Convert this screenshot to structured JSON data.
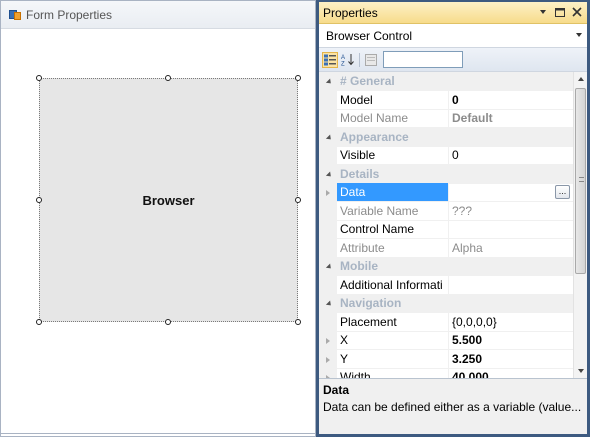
{
  "designer": {
    "title": "Form Properties",
    "control_label": "Browser"
  },
  "properties": {
    "title": "Properties",
    "object_selector": "Browser Control",
    "toolbar": {
      "categorized_icon": "categorized-icon",
      "alphabetical_icon": "sort-az-icon",
      "property_pages_icon": "property-pages-icon",
      "search_value": ""
    },
    "rows": [
      {
        "type": "category",
        "name": "# General"
      },
      {
        "type": "prop",
        "name": "Model",
        "value": "0",
        "value_bold": true
      },
      {
        "type": "prop",
        "name": "Model Name",
        "value": "Default",
        "name_dim": true,
        "value_bold": true,
        "value_dim": true
      },
      {
        "type": "category",
        "name": "Appearance"
      },
      {
        "type": "prop",
        "name": "Visible",
        "value": "0"
      },
      {
        "type": "category",
        "name": "Details"
      },
      {
        "type": "prop",
        "name": "Data",
        "value": "",
        "expandable": true,
        "selected": true,
        "has_ellipsis": true
      },
      {
        "type": "prop",
        "name": "Variable Name",
        "value": "???",
        "name_dim": true,
        "value_dim": true
      },
      {
        "type": "prop",
        "name": "Control Name",
        "value": ""
      },
      {
        "type": "prop",
        "name": "Attribute",
        "value": "Alpha",
        "name_dim": true,
        "value_dim": true
      },
      {
        "type": "category",
        "name": "Mobile"
      },
      {
        "type": "prop",
        "name": "Additional Informati",
        "value": ""
      },
      {
        "type": "category",
        "name": "Navigation"
      },
      {
        "type": "prop",
        "name": "Placement",
        "value": "{0,0,0,0}"
      },
      {
        "type": "prop",
        "name": "X",
        "value": "5.500",
        "expandable": true,
        "value_bold": true
      },
      {
        "type": "prop",
        "name": "Y",
        "value": "3.250",
        "expandable": true,
        "value_bold": true
      },
      {
        "type": "prop",
        "name": "Width",
        "value": "40.000",
        "expandable": true,
        "value_bold": true
      }
    ],
    "description": {
      "title": "Data",
      "text": "Data can be defined either as a variable (value..."
    }
  },
  "colors": {
    "panel_frame": "#3d5a80",
    "title_gradient": "#f7dc8b",
    "selection": "#3399ff",
    "category_text": "#a8b4c3"
  }
}
